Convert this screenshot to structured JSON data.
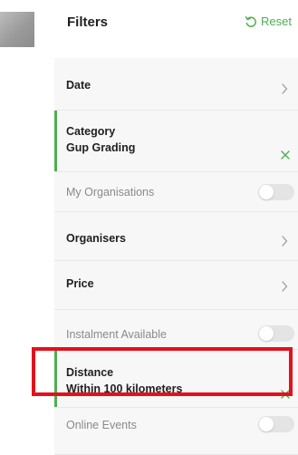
{
  "header": {
    "title": "Filters",
    "reset_label": "Reset"
  },
  "filters": {
    "date": {
      "label": "Date"
    },
    "category": {
      "label": "Category",
      "value": "Gup Grading"
    },
    "my_organisations": {
      "label": "My Organisations",
      "enabled": false
    },
    "organisers": {
      "label": "Organisers"
    },
    "price": {
      "label": "Price"
    },
    "instalment_available": {
      "label": "Instalment Available",
      "enabled": false
    },
    "distance": {
      "label": "Distance",
      "value": "Within 100 kilometers"
    },
    "online_events": {
      "label": "Online Events",
      "enabled": false
    }
  },
  "colors": {
    "accent": "#4caf50",
    "highlight": "#e3111b"
  }
}
